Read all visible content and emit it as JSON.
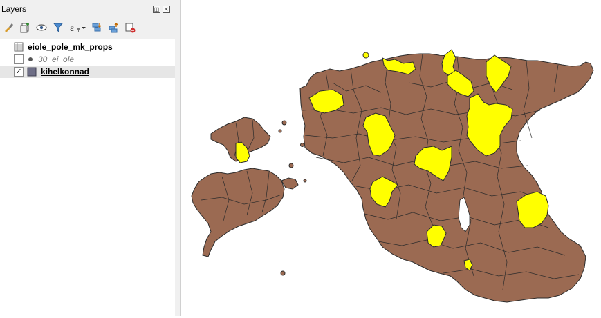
{
  "panel": {
    "title": "Layers"
  },
  "layers": [
    {
      "name": "eiole_pole_mk_props",
      "kind": "table",
      "checked": false
    },
    {
      "name": "30_ei_ole",
      "kind": "point",
      "checked": false
    },
    {
      "name": "kihelkonnad",
      "kind": "polygon",
      "checked": true,
      "selected": true
    }
  ],
  "checkmark": "✓",
  "colors": {
    "parish_fill": "#9b6a52",
    "highlight_fill": "#ffff00",
    "border": "#2b2b2b"
  },
  "icons": [
    "paint-brush-icon",
    "add-group-icon",
    "visibility-eye-icon",
    "filter-icon",
    "expression-filter-icon",
    "expand-all-icon",
    "collapse-all-icon",
    "remove-layer-icon"
  ]
}
